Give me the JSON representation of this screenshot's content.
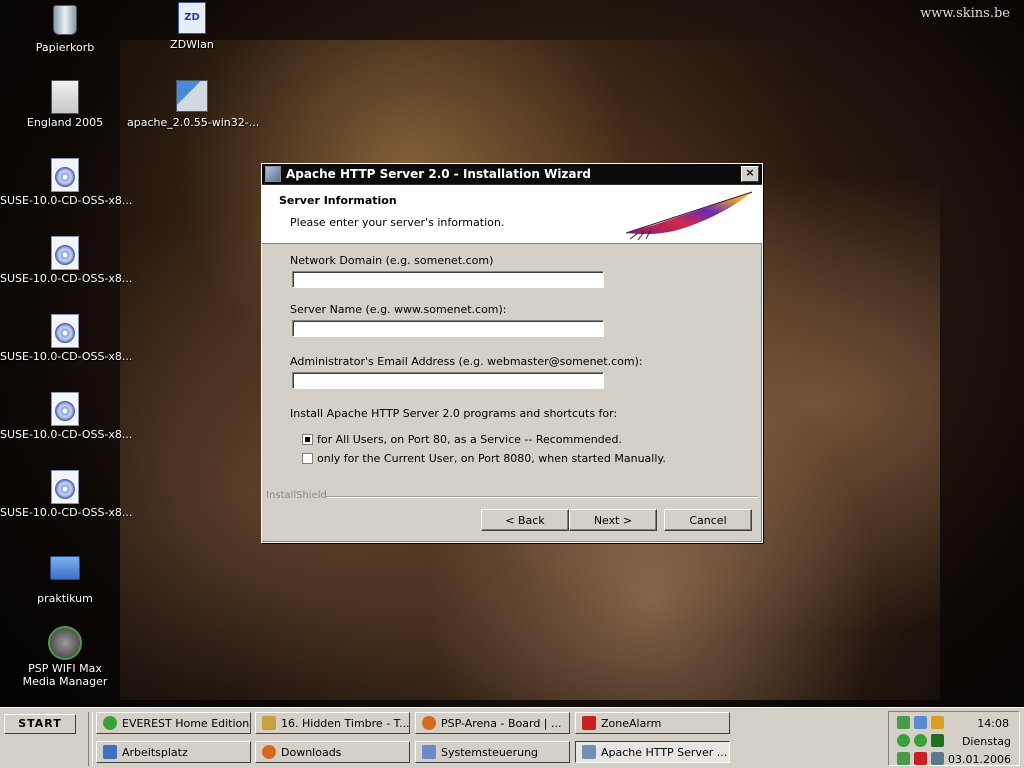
{
  "wallpaper": {
    "watermark": "www.skins.be"
  },
  "desktop_icons": [
    {
      "label": "Papierkorb",
      "icon": "recycle-bin-icon"
    },
    {
      "label": "ZDWlan",
      "icon": "wlan-icon"
    },
    {
      "label": "England 2005",
      "icon": "document-icon"
    },
    {
      "label": "apache_2.0.55-win32-...",
      "icon": "installer-icon"
    },
    {
      "label": "SUSE-10.0-CD-OSS-x8...",
      "icon": "cd-image-icon"
    },
    {
      "label": "SUSE-10.0-CD-OSS-x8...",
      "icon": "cd-image-icon"
    },
    {
      "label": "SUSE-10.0-CD-OSS-x8...",
      "icon": "cd-image-icon"
    },
    {
      "label": "SUSE-10.0-CD-OSS-x8...",
      "icon": "cd-image-icon"
    },
    {
      "label": "SUSE-10.0-CD-OSS-x8...",
      "icon": "cd-image-icon"
    },
    {
      "label": "praktikum",
      "icon": "folder-icon"
    },
    {
      "label": "PSP WIFI Max Media Manager",
      "icon": "psp-media-icon"
    }
  ],
  "dialog": {
    "title": "Apache HTTP Server 2.0 - Installation Wizard",
    "close_label": "×",
    "header_title": "Server Information",
    "header_subtitle": "Please enter your server's information.",
    "fields": {
      "network_domain_label": "Network Domain (e.g. somenet.com)",
      "network_domain_value": "",
      "server_name_label": "Server Name (e.g. www.somenet.com):",
      "server_name_value": "",
      "admin_email_label": "Administrator's Email Address (e.g. webmaster@somenet.com):",
      "admin_email_value": ""
    },
    "install_for_label": "Install Apache HTTP Server 2.0 programs and shortcuts for:",
    "radio_all_users": "for All Users, on Port 80, as a Service -- Recommended.",
    "radio_current_user": "only for the Current User, on Port 8080, when started Manually.",
    "selected_option": "all_users",
    "installshield_label": "InstallShield",
    "back_label": "< Back",
    "next_label": "Next >",
    "cancel_label": "Cancel"
  },
  "taskbar": {
    "start_label": "START",
    "buttons": [
      {
        "label": "EVEREST Home Edition",
        "icon_color": "#3aa03a"
      },
      {
        "label": "16. Hidden Timbre - T...",
        "icon_color": "#c8a040"
      },
      {
        "label": "PSP-Arena - Board | ...",
        "icon_color": "#d86a20"
      },
      {
        "label": "ZoneAlarm",
        "icon_color": "#c82020"
      },
      {
        "label": "Arbeitsplatz",
        "icon_color": "#4070c0"
      },
      {
        "label": "Downloads",
        "icon_color": "#d86a20"
      },
      {
        "label": "Systemsteuerung",
        "icon_color": "#6a8ac8"
      },
      {
        "label": "Apache HTTP Server ...",
        "icon_color": "#7090b0"
      }
    ],
    "active_button": "Apache HTTP Server ...",
    "clock": {
      "time": "14:08",
      "day": "Dienstag",
      "date": "03.01.2006"
    }
  }
}
